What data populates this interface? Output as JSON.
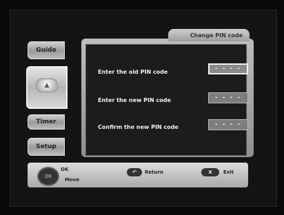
{
  "window": {
    "title": "Change PIN code"
  },
  "sidebar": {
    "items": [
      {
        "label": "Guide"
      },
      {
        "label": ""
      },
      {
        "label": "Timer"
      },
      {
        "label": "Setup"
      }
    ]
  },
  "form": {
    "rows": [
      {
        "label": "Enter the old PIN code",
        "value": "- - - -"
      },
      {
        "label": "Enter the new PIN code",
        "value": "- - - -"
      },
      {
        "label": "Confirm the new PIN code",
        "value": "- - - -"
      }
    ]
  },
  "helpbar": {
    "ok_label": "OK",
    "move_label": "Move",
    "return_label": "Return",
    "exit_label": "Exit",
    "return_key": "↶",
    "exit_key": "X"
  },
  "colors": {
    "panel": "#a5a5a5",
    "panel_inner": "#1c1c1c",
    "text": "#f2f2f2"
  }
}
